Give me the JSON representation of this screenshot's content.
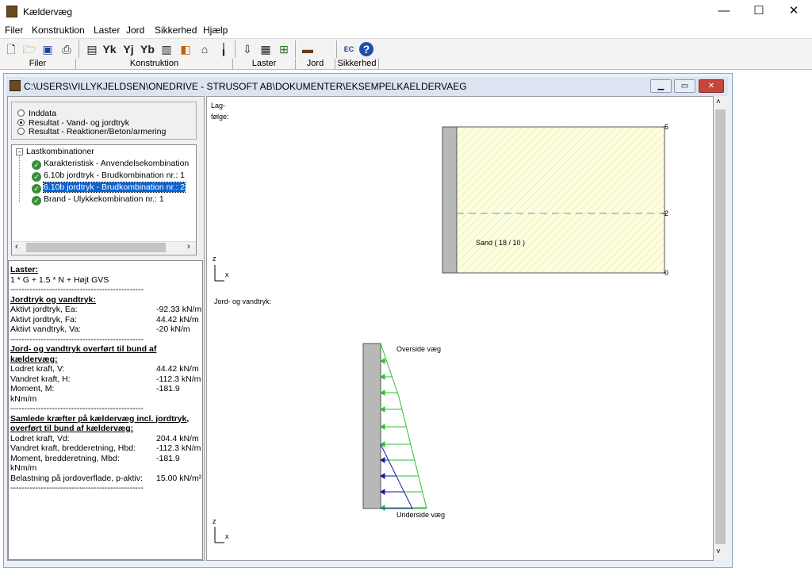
{
  "window": {
    "title": "Kældervæg",
    "minimize": "—",
    "maximize": "☐",
    "close": "✕"
  },
  "menu": [
    "Filer",
    "Konstruktion",
    "Laster",
    "Jord",
    "Sikkerhed",
    "Hjælp"
  ],
  "toolbar_groups": [
    "Filer",
    "Konstruktion",
    "Laster",
    "Jord",
    "Sikkerhed"
  ],
  "toolbar_buttons": [
    "new-icon",
    "open-icon",
    "save-icon",
    "print-icon",
    "document-icon",
    "yk-icon",
    "yj-icon",
    "yb-icon",
    "wall-icon",
    "material-icon",
    "foundation-icon",
    "column-icon",
    "load-icon",
    "load-grid-icon",
    "load-table-icon",
    "soil-icon",
    "ec-icon",
    "help-icon"
  ],
  "toolbar_text": {
    "yk": "Yk",
    "yj": "Yj",
    "yb": "Yb",
    "ec": "EC",
    "help": "?"
  },
  "child": {
    "path": "C:\\USERS\\VILLYKJELDSEN\\ONEDRIVE - STRUSOFT AB\\DOKUMENTER\\EKSEMPELKAELDERVAEG"
  },
  "radios": [
    {
      "label": "Inddata",
      "checked": false
    },
    {
      "label": "Resultat - Vand- og jordtryk",
      "checked": true
    },
    {
      "label": "Resultat - Reaktioner/Beton/armering",
      "checked": false
    }
  ],
  "tree": {
    "root": "Lastkombinationer",
    "items": [
      "Karakteristisk - Anvendelsekombination",
      "6.10b jordtryk - Brudkombination nr.: 1",
      "6.10b jordtryk - Brudkombination nr.: 2",
      "Brand - Ulykkekombination nr.: 1"
    ],
    "selected_index": 2
  },
  "results": {
    "laster_heading": "Laster:",
    "laster_formula": "1 * G + 1.5 * N + Højt GVS",
    "separator": "------------------------------------------------",
    "sec1_heading": "Jordtryk og vandtryk:",
    "sec1": [
      {
        "label": "Aktivt jordtryk, Ea:",
        "value": "-92.33 kN/m"
      },
      {
        "label": "Aktivt jordtryk, Fa:",
        "value": "44.42 kN/m"
      },
      {
        "label": "Aktivt vandtryk, Va:",
        "value": "-20 kN/m"
      }
    ],
    "sec2_heading_1": "Jord- og vandtryk overført til bund af",
    "sec2_heading_2": "kældervæg:",
    "sec2": [
      {
        "label": "Lodret kraft, V:",
        "value": "44.42 kN/m"
      },
      {
        "label": "Vandret kraft, H:",
        "value": "-112.3 kN/m"
      },
      {
        "label": "Moment, M:",
        "value": "-181.9"
      }
    ],
    "sec2_unit": "kNm/m",
    "sec3_heading_1": "Samlede kræfter på kældervæg incl. jordtryk,",
    "sec3_heading_2": "overført til bund af kældervæg:",
    "sec3": [
      {
        "label": "Lodret kraft, Vd:",
        "value": "204.4 kN/m"
      },
      {
        "label": "Vandret kraft, bredderetning, Hbd:",
        "value": "-112.3 kN/m"
      },
      {
        "label": "Moment, bredderetning, Mbd:",
        "value": "-181.9"
      }
    ],
    "sec3_unit": "kNm/m",
    "surface_load": {
      "label": "Belastning på jordoverflade, p-aktiv:",
      "value": "15.00 kN/m²"
    }
  },
  "drawing": {
    "lagfolge_1": "Lag-",
    "lagfolge_2": "følge:",
    "soil_label": "Sand ( 18 / 10 )",
    "level_top": "5",
    "level_water": "2",
    "level_bottom": "0",
    "axis_z": "z",
    "axis_x": "x",
    "pressure_title": "Jord- og vandtryk:",
    "top_label": "Overside væg",
    "bottom_label": "Underside væg",
    "colors": {
      "soil_fill": "#fdfde0",
      "hatch": "#e8e08a",
      "water": "#4fc0e0",
      "wall": "#b8b8b8",
      "earth_pressure": "#2ec02e",
      "water_pressure": "#1a1a9c"
    }
  }
}
